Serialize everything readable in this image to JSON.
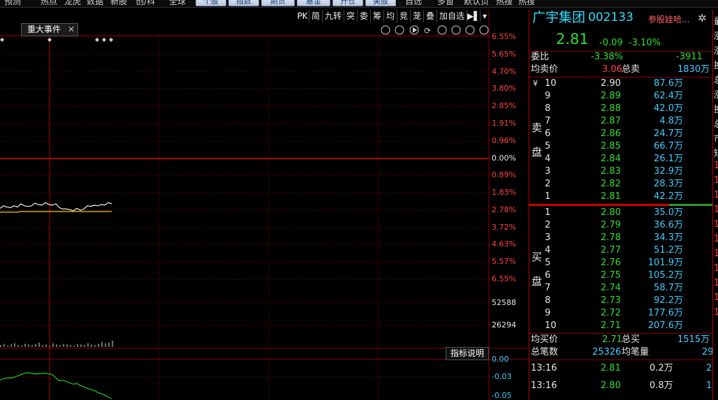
{
  "topnav": {
    "items": [
      "预测",
      "热点",
      "龙虎",
      "数据",
      "新股",
      "创/科",
      "全球",
      "自选",
      "多窗",
      "默认页",
      "热搜",
      "热搜"
    ],
    "buttons": [
      "个股",
      "指数",
      "期货",
      "基金",
      "开仓",
      "美股"
    ]
  },
  "toolbar": {
    "buttons": [
      "PK",
      "简",
      "九转",
      "突",
      "委",
      "筹",
      "均",
      "竞",
      "茏",
      "叠",
      "加自选"
    ],
    "event_tab": "重大事件",
    "indicator_button": "指标说明"
  },
  "chart": {
    "right_axis_price": [
      "6.55%",
      "5.65%",
      "4.70%",
      "3.80%",
      "2.85%",
      "1.91%",
      "0.96%",
      "0.00%",
      "0.89%",
      "1.83%",
      "2.78%",
      "3.72%",
      "4.63%",
      "5.57%",
      "6.55%"
    ],
    "right_axis_volume": [
      "52588",
      "26294"
    ],
    "right_axis_indicator": [
      "0.00",
      "-0.03",
      "-0.05"
    ],
    "price_line": [
      2.822,
      2.826,
      2.824,
      2.823,
      2.826,
      2.824,
      2.829,
      2.826,
      2.825,
      2.826,
      2.83,
      2.828,
      2.827,
      2.831,
      2.828,
      2.827,
      2.829,
      2.823,
      2.821,
      2.821,
      2.82,
      2.818,
      2.822,
      2.819,
      2.821,
      2.826,
      2.825,
      2.827,
      2.826,
      2.828,
      2.827,
      2.831,
      2.829
    ],
    "avg_line": [
      2.816,
      2.816,
      2.816,
      2.816,
      2.816,
      2.816,
      2.817,
      2.817,
      2.817,
      2.817,
      2.817,
      2.817,
      2.817,
      2.817,
      2.817,
      2.817,
      2.817,
      2.817,
      2.817,
      2.817,
      2.817,
      2.817,
      2.817,
      2.817,
      2.817,
      2.817,
      2.817,
      2.817,
      2.817,
      2.817,
      2.817,
      2.817,
      2.817
    ],
    "volume_bars": [
      0.3,
      0.5,
      0.2,
      0.4,
      0.6,
      0.3,
      0.2,
      0.5,
      0.4,
      0.3,
      0.5,
      0.7,
      0.3,
      0.4,
      0.2,
      0.6,
      0.4,
      0.3,
      0.5,
      0.4,
      0.3,
      0.2,
      0.5,
      0.4,
      0.3,
      0.6,
      0.4,
      0.3,
      0.5,
      0.8,
      0.6,
      0.7,
      1.0
    ],
    "indicator_line": [
      -0.03,
      -0.028,
      -0.027,
      -0.027,
      -0.026,
      -0.024,
      -0.022,
      -0.02,
      -0.019,
      -0.02,
      -0.021,
      -0.021,
      -0.02,
      -0.02,
      -0.021,
      -0.022,
      -0.027,
      -0.031,
      -0.03,
      -0.032,
      -0.034,
      -0.036,
      -0.035,
      -0.038,
      -0.04,
      -0.042,
      -0.044,
      -0.045,
      -0.048,
      -0.05,
      -0.052,
      -0.055,
      -0.057
    ]
  },
  "quote": {
    "name": "广宇集团",
    "code": "002133",
    "tag": "参股娃哈...",
    "price": "2.81",
    "change": "-0.09",
    "change_pct": "-3.10%",
    "weibi_label": "委比",
    "weibi": "-3.38%",
    "weicha": "-3911",
    "avg_sell_label": "均卖价",
    "avg_sell": "3.06",
    "total_sell_label": "总卖",
    "total_sell": "1830万",
    "sell_side_label_1": "卖",
    "sell_side_label_2": "盘",
    "buy_side_label_1": "买",
    "buy_side_label_2": "盘",
    "yen_mark": "¥",
    "asks": [
      {
        "level": "10",
        "price": "2.90",
        "vol": "87.6万"
      },
      {
        "level": "9",
        "price": "2.89",
        "vol": "62.4万"
      },
      {
        "level": "8",
        "price": "2.88",
        "vol": "42.0万"
      },
      {
        "level": "7",
        "price": "2.87",
        "vol": "4.8万"
      },
      {
        "level": "6",
        "price": "2.86",
        "vol": "24.7万"
      },
      {
        "level": "5",
        "price": "2.85",
        "vol": "66.7万"
      },
      {
        "level": "4",
        "price": "2.84",
        "vol": "26.1万"
      },
      {
        "level": "3",
        "price": "2.83",
        "vol": "32.9万"
      },
      {
        "level": "2",
        "price": "2.82",
        "vol": "28.3万"
      },
      {
        "level": "1",
        "price": "2.81",
        "vol": "42.2万"
      }
    ],
    "bids": [
      {
        "level": "1",
        "price": "2.80",
        "vol": "35.0万"
      },
      {
        "level": "2",
        "price": "2.79",
        "vol": "36.6万"
      },
      {
        "level": "3",
        "price": "2.78",
        "vol": "34.3万"
      },
      {
        "level": "4",
        "price": "2.77",
        "vol": "51.2万"
      },
      {
        "level": "5",
        "price": "2.76",
        "vol": "101.9万"
      },
      {
        "level": "6",
        "price": "2.75",
        "vol": "105.2万"
      },
      {
        "level": "7",
        "price": "2.74",
        "vol": "58.7万"
      },
      {
        "level": "8",
        "price": "2.73",
        "vol": "92.2万"
      },
      {
        "level": "9",
        "price": "2.72",
        "vol": "177.6万"
      },
      {
        "level": "10",
        "price": "2.71",
        "vol": "207.6万"
      }
    ],
    "avg_buy_label": "均买价",
    "avg_buy": "2.71",
    "total_buy_label": "总买",
    "total_buy": "1515万",
    "trades_label": "总笔数",
    "trades": "25326",
    "avg_trade_label": "均笔量",
    "avg_trade": "29",
    "ticks": [
      {
        "time": "13:16",
        "price": "2.81",
        "vol": "0.2万",
        "n": "2"
      },
      {
        "time": "13:16",
        "price": "2.80",
        "vol": "0.8万",
        "n": "1"
      }
    ]
  },
  "edge_text": [
    "最",
    "涨",
    "涨",
    "换",
    "总",
    "涨",
    "换",
    "总",
    "市",
    "短",
    "1",
    "1",
    "1",
    "1",
    "1",
    "1",
    "1",
    "1",
    "1",
    "1",
    "1"
  ],
  "colors": {
    "up": "#ff4444",
    "down": "#33dd33",
    "grid": "#8a0000",
    "name": "#33ddff",
    "vol": "#44ccff"
  }
}
